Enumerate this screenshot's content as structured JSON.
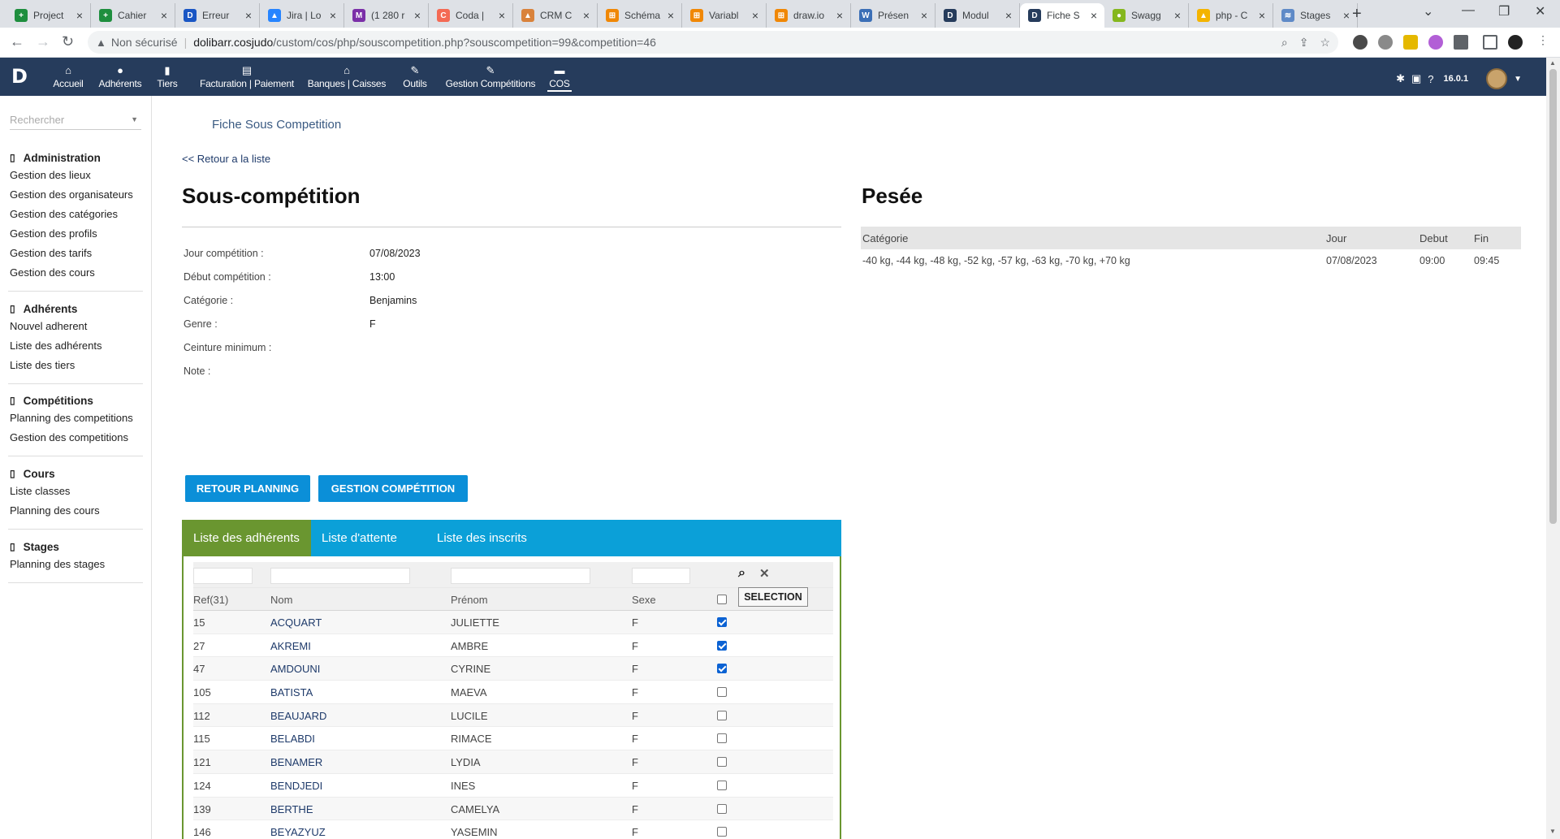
{
  "browser": {
    "tabs": [
      {
        "title": "Project",
        "color": "#1e8e3e",
        "glyph": "+"
      },
      {
        "title": "Cahier",
        "color": "#1e8e3e",
        "glyph": "+"
      },
      {
        "title": "Erreur",
        "color": "#1a56c4",
        "glyph": "D"
      },
      {
        "title": "Jira | Lo",
        "color": "#2684ff",
        "glyph": "▲"
      },
      {
        "title": "(1 280 r",
        "color": "#7b2fa8",
        "glyph": "M"
      },
      {
        "title": "Coda |",
        "color": "#f46a54",
        "glyph": "C"
      },
      {
        "title": "CRM C",
        "color": "#d9823b",
        "glyph": "▲"
      },
      {
        "title": "Schéma",
        "color": "#f08705",
        "glyph": "⊞"
      },
      {
        "title": "Variabl",
        "color": "#f08705",
        "glyph": "⊞"
      },
      {
        "title": "draw.io",
        "color": "#f08705",
        "glyph": "⊞"
      },
      {
        "title": "Présen",
        "color": "#3b6fb6",
        "glyph": "W"
      },
      {
        "title": "Modul",
        "color": "#263c5c",
        "glyph": "D"
      },
      {
        "title": "Fiche S",
        "color": "#263c5c",
        "glyph": "D"
      },
      {
        "title": "Swagg",
        "color": "#85b71e",
        "glyph": "●"
      },
      {
        "title": "php - C",
        "color": "#f4b400",
        "glyph": "▲"
      },
      {
        "title": "Stages",
        "color": "#5f8ac7",
        "glyph": "≋"
      }
    ],
    "active_tab_index": 12,
    "insecure_label": "Non sécurisé",
    "url_host": "dolibarr.cosjudo",
    "url_path": "/custom/cos/php/souscompetition.php?souscompetition=99&competition=46"
  },
  "topmenu": {
    "items": [
      {
        "label": "Accueil",
        "icon": "home-icon",
        "glyph": "⌂"
      },
      {
        "label": "Adhérents",
        "icon": "user-icon",
        "glyph": "●"
      },
      {
        "label": "Tiers",
        "icon": "building-icon",
        "glyph": "▮"
      },
      {
        "label": "Facturation | Paiement",
        "icon": "money-icon",
        "glyph": "▤"
      },
      {
        "label": "Banques | Caisses",
        "icon": "bank-icon",
        "glyph": "⌂"
      },
      {
        "label": "Outils",
        "icon": "wrench-icon",
        "glyph": "✎"
      },
      {
        "label": "Gestion Compétitions",
        "icon": "edit-icon",
        "glyph": "✎"
      },
      {
        "label": "COS",
        "icon": "note-icon",
        "glyph": "▬"
      }
    ],
    "selected_index": 7,
    "version": "16.0.1"
  },
  "sidebar": {
    "search_placeholder": "Rechercher",
    "sections": [
      {
        "title": "Administration",
        "items": [
          "Gestion des lieux",
          "Gestion des organisateurs",
          "Gestion des catégories",
          "Gestion des profils",
          "Gestion des tarifs",
          "Gestion des cours"
        ]
      },
      {
        "title": "Adhérents",
        "items": [
          "Nouvel adherent",
          "Liste des adhérents",
          "Liste des tiers"
        ]
      },
      {
        "title": "Compétitions",
        "items": [
          "Planning des competitions",
          "Gestion des competitions"
        ]
      },
      {
        "title": "Cours",
        "items": [
          "Liste classes",
          "Planning des cours"
        ]
      },
      {
        "title": "Stages",
        "items": [
          "Planning des stages"
        ]
      }
    ]
  },
  "page": {
    "fiche_title": "Fiche Sous Competition",
    "back_link": "<< Retour a la liste",
    "heading": "Sous-compétition",
    "fields": [
      {
        "label": "Jour compétition :",
        "value": "07/08/2023"
      },
      {
        "label": "Début compétition :",
        "value": "13:00"
      },
      {
        "label": "Catégorie :",
        "value": "Benjamins"
      },
      {
        "label": "Genre :",
        "value": "F"
      },
      {
        "label": "Ceinture minimum :",
        "value": ""
      },
      {
        "label": "Note :",
        "value": ""
      }
    ],
    "btn_retour": "RETOUR PLANNING",
    "btn_gestion": "GESTION COMPÉTITION"
  },
  "pesee": {
    "heading": "Pesée",
    "headers": {
      "categorie": "Catégorie",
      "jour": "Jour",
      "debut": "Debut",
      "fin": "Fin"
    },
    "rows": [
      {
        "categorie": "-40 kg, -44 kg, -48 kg, -52 kg, -57 kg, -63 kg, -70 kg, +70 kg",
        "jour": "07/08/2023",
        "debut": "09:00",
        "fin": "09:45"
      }
    ]
  },
  "list_tabs": {
    "items": [
      "Liste des adhérents",
      "Liste d'attente",
      "Liste des inscrits"
    ],
    "active_index": 0
  },
  "members": {
    "headers": {
      "ref": "Ref(31)",
      "nom": "Nom",
      "prenom": "Prénom",
      "sexe": "Sexe"
    },
    "selection_label": "SELECTION",
    "rows": [
      {
        "ref": "15",
        "nom": "ACQUART",
        "prenom": "JULIETTE",
        "sexe": "F",
        "checked": true
      },
      {
        "ref": "27",
        "nom": "AKREMI",
        "prenom": "AMBRE",
        "sexe": "F",
        "checked": true
      },
      {
        "ref": "47",
        "nom": "AMDOUNI",
        "prenom": "CYRINE",
        "sexe": "F",
        "checked": true
      },
      {
        "ref": "105",
        "nom": "BATISTA",
        "prenom": "MAEVA",
        "sexe": "F",
        "checked": false
      },
      {
        "ref": "112",
        "nom": "BEAUJARD",
        "prenom": "LUCILE",
        "sexe": "F",
        "checked": false
      },
      {
        "ref": "115",
        "nom": "BELABDI",
        "prenom": "RIMACE",
        "sexe": "F",
        "checked": false
      },
      {
        "ref": "121",
        "nom": "BENAMER",
        "prenom": "LYDIA",
        "sexe": "F",
        "checked": false
      },
      {
        "ref": "124",
        "nom": "BENDJEDI",
        "prenom": "INES",
        "sexe": "F",
        "checked": false
      },
      {
        "ref": "139",
        "nom": "BERTHE",
        "prenom": "CAMELYA",
        "sexe": "F",
        "checked": false
      },
      {
        "ref": "146",
        "nom": "BEYAZYUZ",
        "prenom": "YASEMIN",
        "sexe": "F",
        "checked": false
      }
    ]
  }
}
